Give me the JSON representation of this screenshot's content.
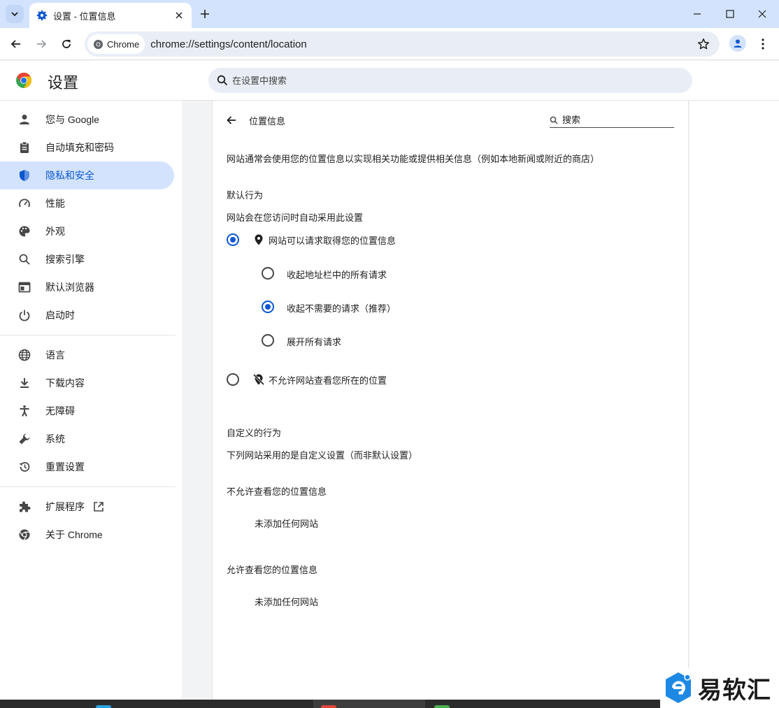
{
  "tab": {
    "title": "设置 - 位置信息"
  },
  "toolbar": {
    "chip_label": "Chrome",
    "url": "chrome://settings/content/location"
  },
  "header": {
    "title": "设置",
    "search_placeholder": "在设置中搜索"
  },
  "sidebar": {
    "items": [
      {
        "label": "您与 Google",
        "icon": "person-icon"
      },
      {
        "label": "自动填充和密码",
        "icon": "clipboard-icon"
      },
      {
        "label": "隐私和安全",
        "icon": "shield-icon",
        "active": true
      },
      {
        "label": "性能",
        "icon": "speedometer-icon"
      },
      {
        "label": "外观",
        "icon": "palette-icon"
      },
      {
        "label": "搜索引擎",
        "icon": "search-icon"
      },
      {
        "label": "默认浏览器",
        "icon": "browser-icon"
      },
      {
        "label": "启动时",
        "icon": "power-icon"
      },
      {
        "label": "语言",
        "icon": "globe-icon"
      },
      {
        "label": "下载内容",
        "icon": "download-icon"
      },
      {
        "label": "无障碍",
        "icon": "accessibility-icon"
      },
      {
        "label": "系统",
        "icon": "wrench-icon"
      },
      {
        "label": "重置设置",
        "icon": "restore-icon"
      },
      {
        "label": "扩展程序",
        "icon": "puzzle-icon"
      },
      {
        "label": "关于 Chrome",
        "icon": "chrome-icon"
      }
    ]
  },
  "main": {
    "title": "位置信息",
    "search_placeholder": "搜索",
    "description": "网站通常会使用您的位置信息以实现相关功能或提供相关信息（例如本地新闻或附近的商店）",
    "default_heading": "默认行为",
    "default_sub": "网站会在您访问时自动采用此设置",
    "options": {
      "allow": "网站可以请求取得您的位置信息",
      "quiet_all": "收起地址栏中的所有请求",
      "quiet_unneeded": "收起不需要的请求（推荐）",
      "expand_all": "展开所有请求",
      "block": "不允许网站查看您所在的位置"
    },
    "custom_heading": "自定义的行为",
    "custom_sub": "下列网站采用的是自定义设置（而非默认设置）",
    "blocked_heading": "不允许查看您的位置信息",
    "blocked_empty": "未添加任何网站",
    "allowed_heading": "允许查看您的位置信息",
    "allowed_empty": "未添加任何网站"
  },
  "watermark": {
    "text": "易软汇"
  }
}
